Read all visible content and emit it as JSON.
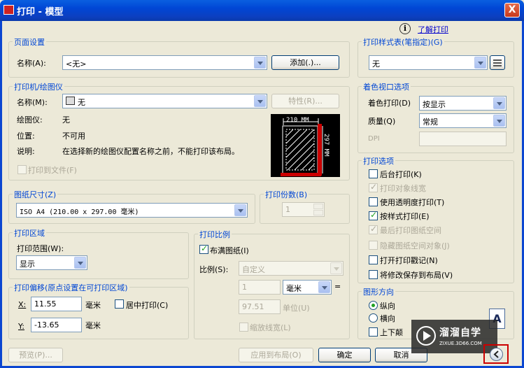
{
  "window": {
    "title": "打印 - 模型",
    "close": "X"
  },
  "help": {
    "icon_glyph": "i",
    "link": "了解打印"
  },
  "page_setup": {
    "group": "页面设置",
    "name_label": "名称(A):",
    "name_value": "<无>",
    "add_button": "添加(.)..."
  },
  "printer": {
    "group": "打印机/绘图仪",
    "name_label": "名称(M):",
    "name_value": "无",
    "properties_button": "特性(R)...",
    "plotter_label": "绘图仪:",
    "plotter_value": "无",
    "location_label": "位置:",
    "location_value": "不可用",
    "desc_label": "说明:",
    "desc_value": "在选择新的绘图仪配置名称之前，不能打印该布局。",
    "print_to_file": "打印到文件(F)",
    "preview_width": "210 MM",
    "preview_height": "297 MM"
  },
  "paper_size": {
    "group": "图纸尺寸(Z)",
    "value": "ISO A4 (210.00 x 297.00 毫米)"
  },
  "copies": {
    "group": "打印份数(B)",
    "value": "1"
  },
  "plot_area": {
    "group": "打印区域",
    "range_label": "打印范围(W):",
    "range_value": "显示"
  },
  "plot_scale": {
    "group": "打印比例",
    "fit_paper": "布满图纸(I)",
    "scale_label": "比例(S):",
    "scale_value": "自定义",
    "value1": "1",
    "unit_value": "毫米",
    "equals": "=",
    "value2": "97.51",
    "unit_label": "单位(U)",
    "scale_lineweights": "缩放线宽(L)"
  },
  "plot_offset": {
    "group": "打印偏移(原点设置在可打印区域)",
    "x_label": "X:",
    "x_value": "11.55",
    "x_unit": "毫米",
    "center": "居中打印(C)",
    "y_label": "Y:",
    "y_value": "-13.65",
    "y_unit": "毫米"
  },
  "plot_style": {
    "group": "打印样式表(笔指定)(G)",
    "value": "无"
  },
  "shaded": {
    "group": "着色视口选项",
    "shade_label": "着色打印(D)",
    "shade_value": "按显示",
    "quality_label": "质量(Q)",
    "quality_value": "常规",
    "dpi_label": "DPI"
  },
  "options": {
    "group": "打印选项",
    "items": [
      {
        "label": "后台打印(K)",
        "checked": false,
        "disabled": false
      },
      {
        "label": "打印对象线宽",
        "checked": true,
        "disabled": true
      },
      {
        "label": "使用透明度打印(T)",
        "checked": false,
        "disabled": false
      },
      {
        "label": "按样式打印(E)",
        "checked": true,
        "disabled": false
      },
      {
        "label": "最后打印图纸空间",
        "checked": true,
        "disabled": true
      },
      {
        "label": "隐藏图纸空间对象(J)",
        "checked": false,
        "disabled": true
      },
      {
        "label": "打开打印戳记(N)",
        "checked": false,
        "disabled": false
      },
      {
        "label": "将修改保存到布局(V)",
        "checked": false,
        "disabled": false
      }
    ]
  },
  "orientation": {
    "group": "图形方向",
    "portrait": "纵向",
    "landscape": "横向",
    "upside_down": "上下颠",
    "paper_letter": "A"
  },
  "footer": {
    "preview": "预览(P)...",
    "apply": "应用到布局(O)",
    "ok": "确定",
    "cancel": "取消"
  },
  "watermark": {
    "brand": "溜溜自学",
    "url": "ZIXUE.3D66.COM"
  },
  "colors": {
    "accent": "#0046d5",
    "highlight_red": "#cc0000"
  }
}
